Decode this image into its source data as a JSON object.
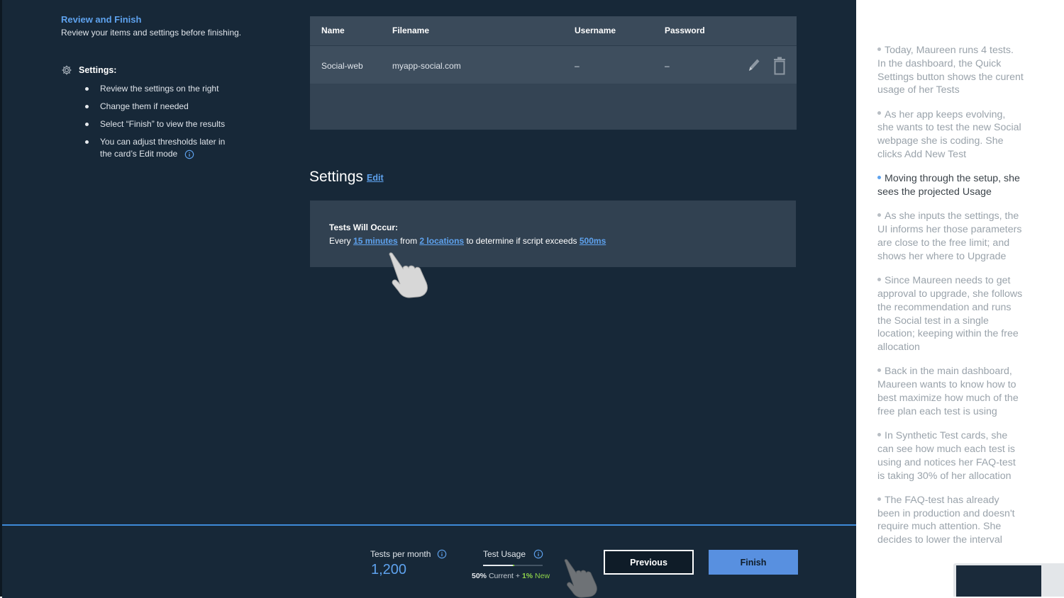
{
  "wizard": {
    "step_title": "Review and Finish",
    "step_desc": "Review your items and settings before finishing.",
    "settings_label": "Settings:",
    "instructions": [
      "Review the settings on the right",
      "Change them if needed",
      "Select “Finish” to view the results",
      "You can adjust thresholds later in the card’s Edit mode"
    ]
  },
  "table": {
    "columns": [
      "Name",
      "Filename",
      "Username",
      "Password"
    ],
    "rows": [
      {
        "name": "Social-web",
        "filename": "myapp-social.com",
        "username": "–",
        "password": "–"
      }
    ]
  },
  "settings": {
    "title": "Settings",
    "edit_label": "Edit",
    "occur_title": "Tests Will Occur:",
    "every": "Every",
    "interval": "15 minutes",
    "from": "from",
    "locations": "2 locations",
    "determine": "to determine if script exceeds",
    "threshold": "500ms"
  },
  "footer": {
    "tests_per_month_label": "Tests per month",
    "tests_per_month_value": "1,200",
    "test_usage_label": "Test Usage",
    "current_pct": "50%",
    "current_label": "Current",
    "plus": "+",
    "new_pct": "1%",
    "new_label": "New",
    "current_fraction": 0.5,
    "new_fraction": 0.01,
    "previous_label": "Previous",
    "finish_label": "Finish"
  },
  "notes": [
    {
      "text": "Today, Maureen runs 4 tests. In the dashboard, the Quick Settings button shows the curent usage of her Tests",
      "active": false
    },
    {
      "text": "As her app keeps evolving, she wants to test the new Social webpage she is coding. She clicks Add New Test",
      "active": false
    },
    {
      "text": "Moving through the setup, she sees the projected Usage",
      "active": true
    },
    {
      "text": "As she inputs the settings, the UI informs her those parameters are close to the free limit; and shows her where to Upgrade",
      "active": false
    },
    {
      "text": "Since Maureen needs to get approval to upgrade, she follows the recommendation and runs the Social test in a single location; keeping within the free allocation",
      "active": false
    },
    {
      "text": "Back in the main dashboard, Maureen wants to know how to best maximize how much of the free plan each test is using",
      "active": false
    },
    {
      "text": "In Synthetic Test cards, she can see how much each test is using and notices her FAQ-test is taking 30% of her allocation",
      "active": false
    },
    {
      "text": "The FAQ-test has already been in production and doesn't require much attention. She decides to lower the interval",
      "active": false
    }
  ],
  "colors": {
    "background": "#172838",
    "accent": "#5ea2ee",
    "finish_button": "#5890e0",
    "new_usage": "#8dd24a"
  }
}
